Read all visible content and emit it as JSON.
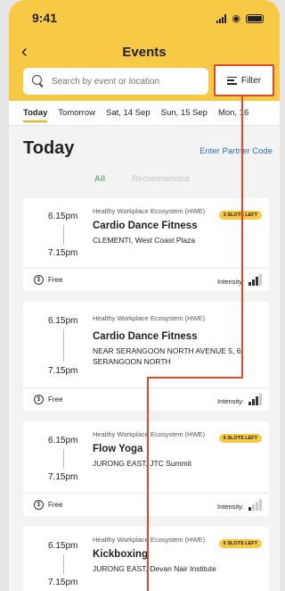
{
  "status": {
    "time": "9:41"
  },
  "header": {
    "title": "Events"
  },
  "search": {
    "placeholder": "Search by event or location"
  },
  "filter": {
    "label": "Filter"
  },
  "date_tabs": [
    "Today",
    "Tomorrow",
    "Sat, 14 Sep",
    "Sun, 15 Sep",
    "Mon, 16"
  ],
  "section": {
    "title": "Today",
    "partner_link": "Enter Partner Code"
  },
  "filters": {
    "all": "All",
    "recommended": "Recommended"
  },
  "colors": {
    "accent": "#f7c945",
    "annotation": "#e04a2b",
    "link": "#2f6fb0"
  },
  "events": [
    {
      "start": "6.15pm",
      "end": "7.15pm",
      "org": "Healthy Workplace Ecosystem (HWE)",
      "title": "Cardio Dance Fitness",
      "location": "CLEMENTI, West Coast Plaza",
      "slots": "3 SLOTS LEFT",
      "price": "Free",
      "intensity_label": "Intensity:",
      "intensity_level": 3
    },
    {
      "start": "6.15pm",
      "end": "7.15pm",
      "org": "Healthy Workplace Ecosystem (HWE)",
      "title": "Cardio Dance Fitness",
      "location": "NEAR SERANGOON NORTH AVENUE 5, 6 SERANGOON NORTH",
      "slots": "",
      "price": "Free",
      "intensity_label": "Intensity:",
      "intensity_level": 3
    },
    {
      "start": "6.15pm",
      "end": "7.15pm",
      "org": "Healthy Workplace Ecosystem (HWE)",
      "title": "Flow Yoga",
      "location": "JURONG EAST, JTC Summit",
      "slots": "6 SLOTS LEFT",
      "price": "Free",
      "intensity_label": "Intensity:",
      "intensity_level": 1
    },
    {
      "start": "6.15pm",
      "end": "7.15pm",
      "org": "Healthy Workplace Ecosystem (HWE)",
      "title": "Kickboxing",
      "location": "JURONG EAST, Devan Nair Institute",
      "slots": "6 SLOTS LEFT",
      "price": "",
      "intensity_label": "",
      "intensity_level": 0
    }
  ]
}
